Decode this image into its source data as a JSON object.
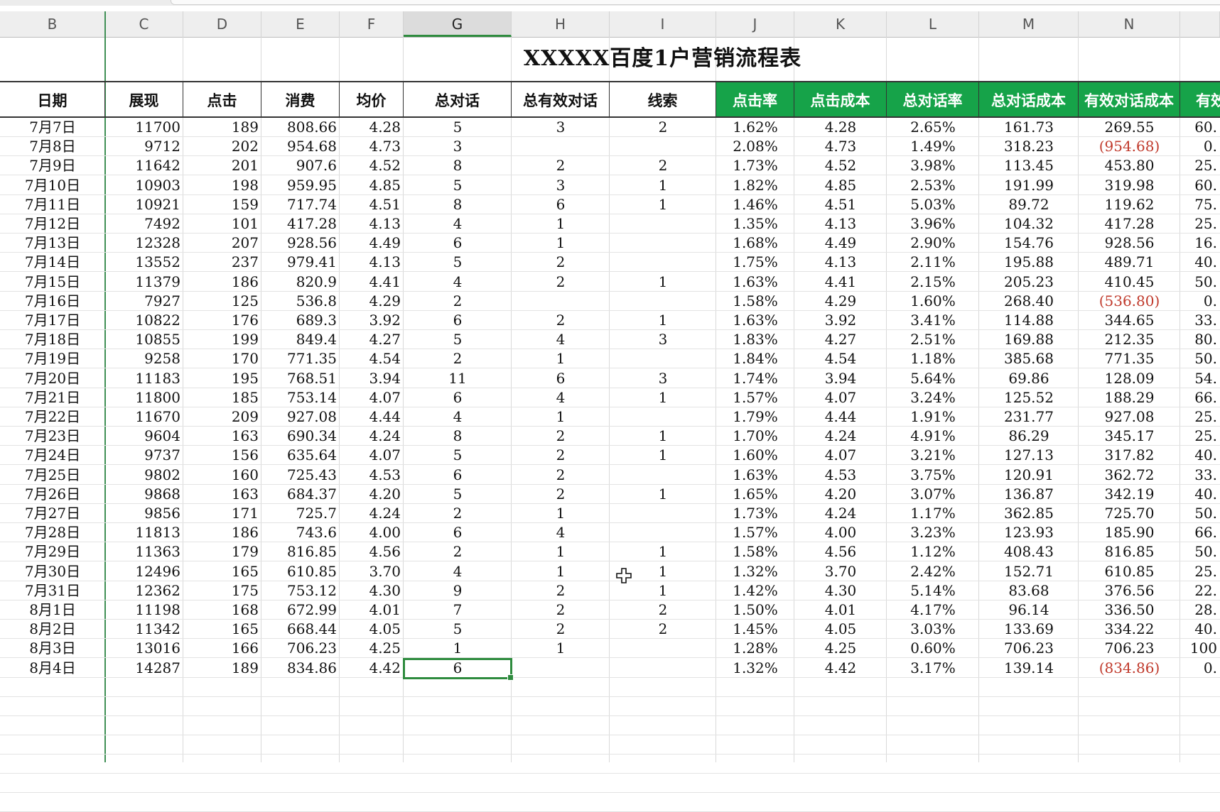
{
  "spreadsheet": {
    "columns": [
      "B",
      "C",
      "D",
      "E",
      "F",
      "G",
      "H",
      "I",
      "J",
      "K",
      "L",
      "M",
      "N"
    ],
    "selected_column": "G",
    "title": "XXXXX百度1户营销流程表",
    "headers": [
      "日期",
      "展现",
      "点击",
      "消费",
      "均价",
      "总对话",
      "总有效对话",
      "线索",
      "点击率",
      "点击成本",
      "总对话率",
      "总对话成本",
      "有效对话成本",
      "有效"
    ],
    "rows": [
      [
        "7月7日",
        "11700",
        "189",
        "808.66",
        "4.28",
        "5",
        "3",
        "2",
        "1.62%",
        "4.28",
        "2.65%",
        "161.73",
        "269.55",
        "60."
      ],
      [
        "7月8日",
        "9712",
        "202",
        "954.68",
        "4.73",
        "3",
        "",
        "",
        "2.08%",
        "4.73",
        "1.49%",
        "318.23",
        "(954.68)",
        "0."
      ],
      [
        "7月9日",
        "11642",
        "201",
        "907.6",
        "4.52",
        "8",
        "2",
        "2",
        "1.73%",
        "4.52",
        "3.98%",
        "113.45",
        "453.80",
        "25."
      ],
      [
        "7月10日",
        "10903",
        "198",
        "959.95",
        "4.85",
        "5",
        "3",
        "1",
        "1.82%",
        "4.85",
        "2.53%",
        "191.99",
        "319.98",
        "60."
      ],
      [
        "7月11日",
        "10921",
        "159",
        "717.74",
        "4.51",
        "8",
        "6",
        "1",
        "1.46%",
        "4.51",
        "5.03%",
        "89.72",
        "119.62",
        "75."
      ],
      [
        "7月12日",
        "7492",
        "101",
        "417.28",
        "4.13",
        "4",
        "1",
        "",
        "1.35%",
        "4.13",
        "3.96%",
        "104.32",
        "417.28",
        "25."
      ],
      [
        "7月13日",
        "12328",
        "207",
        "928.56",
        "4.49",
        "6",
        "1",
        "",
        "1.68%",
        "4.49",
        "2.90%",
        "154.76",
        "928.56",
        "16."
      ],
      [
        "7月14日",
        "13552",
        "237",
        "979.41",
        "4.13",
        "5",
        "2",
        "",
        "1.75%",
        "4.13",
        "2.11%",
        "195.88",
        "489.71",
        "40."
      ],
      [
        "7月15日",
        "11379",
        "186",
        "820.9",
        "4.41",
        "4",
        "2",
        "1",
        "1.63%",
        "4.41",
        "2.15%",
        "205.23",
        "410.45",
        "50."
      ],
      [
        "7月16日",
        "7927",
        "125",
        "536.8",
        "4.29",
        "2",
        "",
        "",
        "1.58%",
        "4.29",
        "1.60%",
        "268.40",
        "(536.80)",
        "0."
      ],
      [
        "7月17日",
        "10822",
        "176",
        "689.3",
        "3.92",
        "6",
        "2",
        "1",
        "1.63%",
        "3.92",
        "3.41%",
        "114.88",
        "344.65",
        "33."
      ],
      [
        "7月18日",
        "10855",
        "199",
        "849.4",
        "4.27",
        "5",
        "4",
        "3",
        "1.83%",
        "4.27",
        "2.51%",
        "169.88",
        "212.35",
        "80."
      ],
      [
        "7月19日",
        "9258",
        "170",
        "771.35",
        "4.54",
        "2",
        "1",
        "",
        "1.84%",
        "4.54",
        "1.18%",
        "385.68",
        "771.35",
        "50."
      ],
      [
        "7月20日",
        "11183",
        "195",
        "768.51",
        "3.94",
        "11",
        "6",
        "3",
        "1.74%",
        "3.94",
        "5.64%",
        "69.86",
        "128.09",
        "54."
      ],
      [
        "7月21日",
        "11800",
        "185",
        "753.14",
        "4.07",
        "6",
        "4",
        "1",
        "1.57%",
        "4.07",
        "3.24%",
        "125.52",
        "188.29",
        "66."
      ],
      [
        "7月22日",
        "11670",
        "209",
        "927.08",
        "4.44",
        "4",
        "1",
        "",
        "1.79%",
        "4.44",
        "1.91%",
        "231.77",
        "927.08",
        "25."
      ],
      [
        "7月23日",
        "9604",
        "163",
        "690.34",
        "4.24",
        "8",
        "2",
        "1",
        "1.70%",
        "4.24",
        "4.91%",
        "86.29",
        "345.17",
        "25."
      ],
      [
        "7月24日",
        "9737",
        "156",
        "635.64",
        "4.07",
        "5",
        "2",
        "1",
        "1.60%",
        "4.07",
        "3.21%",
        "127.13",
        "317.82",
        "40."
      ],
      [
        "7月25日",
        "9802",
        "160",
        "725.43",
        "4.53",
        "6",
        "2",
        "",
        "1.63%",
        "4.53",
        "3.75%",
        "120.91",
        "362.72",
        "33."
      ],
      [
        "7月26日",
        "9868",
        "163",
        "684.37",
        "4.20",
        "5",
        "2",
        "1",
        "1.65%",
        "4.20",
        "3.07%",
        "136.87",
        "342.19",
        "40."
      ],
      [
        "7月27日",
        "9856",
        "171",
        "725.7",
        "4.24",
        "2",
        "1",
        "",
        "1.73%",
        "4.24",
        "1.17%",
        "362.85",
        "725.70",
        "50."
      ],
      [
        "7月28日",
        "11813",
        "186",
        "743.6",
        "4.00",
        "6",
        "4",
        "",
        "1.57%",
        "4.00",
        "3.23%",
        "123.93",
        "185.90",
        "66."
      ],
      [
        "7月29日",
        "11363",
        "179",
        "816.85",
        "4.56",
        "2",
        "1",
        "1",
        "1.58%",
        "4.56",
        "1.12%",
        "408.43",
        "816.85",
        "50."
      ],
      [
        "7月30日",
        "12496",
        "165",
        "610.85",
        "3.70",
        "4",
        "1",
        "1",
        "1.32%",
        "3.70",
        "2.42%",
        "152.71",
        "610.85",
        "25."
      ],
      [
        "7月31日",
        "12362",
        "175",
        "753.12",
        "4.30",
        "9",
        "2",
        "1",
        "1.42%",
        "4.30",
        "5.14%",
        "83.68",
        "376.56",
        "22."
      ],
      [
        "8月1日",
        "11198",
        "168",
        "672.99",
        "4.01",
        "7",
        "2",
        "2",
        "1.50%",
        "4.01",
        "4.17%",
        "96.14",
        "336.50",
        "28."
      ],
      [
        "8月2日",
        "11342",
        "165",
        "668.44",
        "4.05",
        "5",
        "2",
        "2",
        "1.45%",
        "4.05",
        "3.03%",
        "133.69",
        "334.22",
        "40."
      ],
      [
        "8月3日",
        "13016",
        "166",
        "706.23",
        "4.25",
        "1",
        "1",
        "",
        "1.28%",
        "4.25",
        "0.60%",
        "706.23",
        "706.23",
        "100"
      ],
      [
        "8月4日",
        "14287",
        "189",
        "834.86",
        "4.42",
        "6",
        "",
        "",
        "1.32%",
        "4.42",
        "3.17%",
        "139.14",
        "(834.86)",
        "0."
      ]
    ],
    "colors": {
      "header_green": "#16a349",
      "negative_red": "#c0392b",
      "selection_green": "#2e8b3e"
    }
  }
}
